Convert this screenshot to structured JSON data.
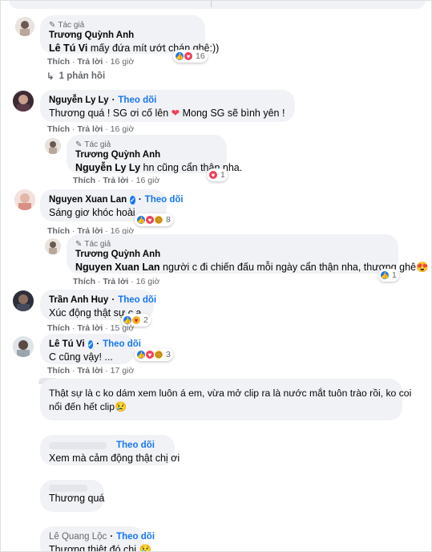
{
  "comments": [
    {
      "author_tag": "Tác giả",
      "name": "Trương Quỳnh Anh",
      "mention": "Lê Tú Vi",
      "text": " mấy đứa mít ướt chán ghê:))",
      "like_label": "Thích",
      "reply_label": "Trả lời",
      "time": "16 giờ",
      "reaction_count": "16"
    },
    {
      "replies_link": "1 phản hồi"
    },
    {
      "name": "Nguyễn Ly Ly",
      "follow_label": "Theo dõi",
      "text": "Thương quá ! SG ơi cố lên",
      "text_after": " Mong SG sẽ bình yên !",
      "like_label": "Thích",
      "reply_label": "Trả lời",
      "time": "16 giờ"
    },
    {
      "author_tag": "Tác giả",
      "name": "Trương Quỳnh Anh",
      "mention": "Nguyễn Ly Ly",
      "text": " hn cũng cẩn thận nha.",
      "like_label": "Thích",
      "reply_label": "Trả lời",
      "time": "16 giờ",
      "reaction_count": "1"
    },
    {
      "name": "Nguyen Xuan Lan",
      "follow_label": "Theo dõi",
      "text": "Sáng giơ khóc hoài",
      "like_label": "Thích",
      "reply_label": "Trả lời",
      "time": "16 giờ",
      "reaction_count": "8"
    },
    {
      "author_tag": "Tác giả",
      "name": "Trương Quỳnh Anh",
      "mention": "Nguyen Xuan Lan",
      "text": " người c đi chiến đấu mỗi ngày cẩn thận nha, thương ghê",
      "like_label": "Thích",
      "reply_label": "Trả lời",
      "time": "16 giờ",
      "reaction_count": "1"
    },
    {
      "name": "Trần Anh Huy",
      "follow_label": "Theo dõi",
      "text": "Xúc động thật sự c ạ",
      "like_label": "Thích",
      "reply_label": "Trả lời",
      "time": "15 giờ",
      "reaction_count": "2"
    },
    {
      "name": "Lê Tú Vi",
      "follow_label": "Theo dõi",
      "text": "C cũng vậy! ...",
      "like_label": "Thích",
      "reply_label": "Trả lời",
      "time": "17 giờ",
      "reaction_count": "3"
    },
    {
      "text_line1": "Thật sự là c ko dám xem luôn á em, vừa mở clip ra là nước mắt tuôn trào rồi, ko coi",
      "text_line2": "nổi đến hết clip"
    },
    {
      "follow_label": "Theo dõi",
      "text": "Xem mà cảm động thật chị ơi"
    },
    {
      "text": "Thương quá"
    },
    {
      "name": "Lê Quang Lộc",
      "follow_label": "Theo dõi",
      "text": "Thương thiệt đó chị"
    }
  ],
  "colors": {
    "accent": "#1877f2",
    "bubble": "#f0f2f5",
    "muted": "#65676b",
    "heart": "#f33e58"
  }
}
